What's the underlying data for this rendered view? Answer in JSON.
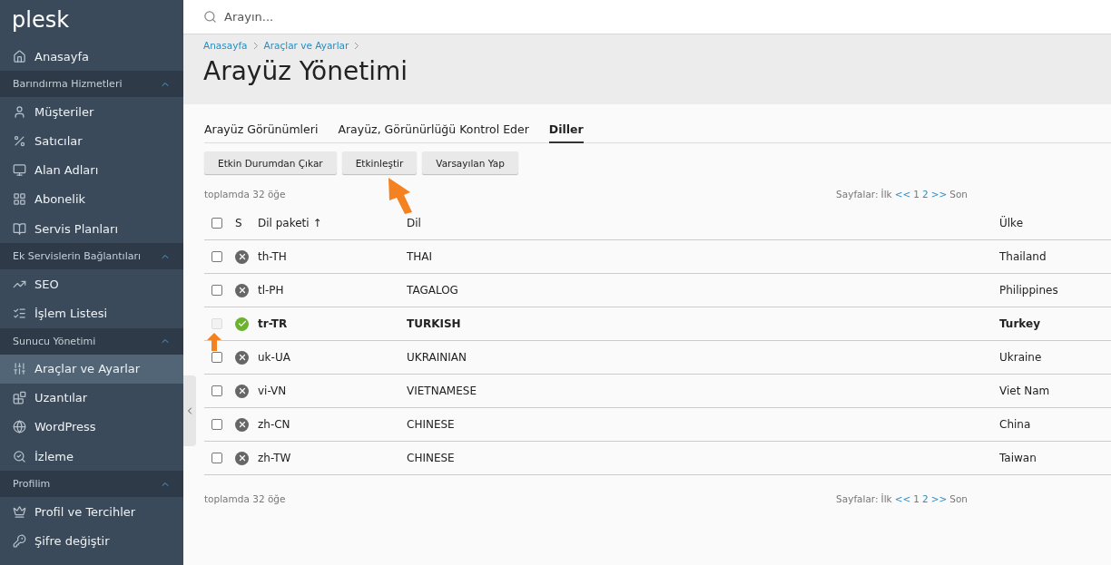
{
  "sidebar": {
    "logo": "plesk",
    "items": [
      {
        "kind": "item",
        "label": "Anasayfa",
        "selected": false
      },
      {
        "kind": "section",
        "label": "Barındırma Hizmetleri",
        "expanded": true
      },
      {
        "kind": "item",
        "label": "Müşteriler",
        "selected": false
      },
      {
        "kind": "item",
        "label": "Satıcılar",
        "selected": false
      },
      {
        "kind": "item",
        "label": "Alan Adları",
        "selected": false
      },
      {
        "kind": "item",
        "label": "Abonelik",
        "selected": false
      },
      {
        "kind": "item",
        "label": "Servis Planları",
        "selected": false
      },
      {
        "kind": "section",
        "label": "Ek Servislerin Bağlantıları",
        "expanded": true
      },
      {
        "kind": "item",
        "label": "SEO",
        "selected": false
      },
      {
        "kind": "item",
        "label": "İşlem Listesi",
        "selected": false
      },
      {
        "kind": "section",
        "label": "Sunucu Yönetimi",
        "expanded": true
      },
      {
        "kind": "item",
        "label": "Araçlar ve Ayarlar",
        "selected": true
      },
      {
        "kind": "item",
        "label": "Uzantılar",
        "selected": false
      },
      {
        "kind": "item",
        "label": "WordPress",
        "selected": false
      },
      {
        "kind": "item",
        "label": "İzleme",
        "selected": false
      },
      {
        "kind": "section",
        "label": "Profilim",
        "expanded": true
      },
      {
        "kind": "item",
        "label": "Profil ve Tercihler",
        "selected": false
      },
      {
        "kind": "item",
        "label": "Şifre değiştir",
        "selected": false
      }
    ]
  },
  "search": {
    "placeholder": "Arayın..."
  },
  "breadcrumbs": [
    "Anasayfa",
    "Araçlar ve Ayarlar"
  ],
  "title": "Arayüz Yönetimi",
  "tabs": [
    {
      "label": "Arayüz Görünümleri",
      "selected": false
    },
    {
      "label": "Arayüz, Görünürlüğü Kontrol Eder",
      "selected": false
    },
    {
      "label": "Diller",
      "selected": true
    }
  ],
  "buttons": [
    "Etkin Durumdan Çıkar",
    "Etkinleştir",
    "Varsayılan Yap"
  ],
  "total": "toplamda 32 öğe",
  "pager": {
    "label": "Sayfalar:",
    "items": [
      {
        "text": "İlk",
        "link": false
      },
      {
        "text": "<<",
        "link": true
      },
      {
        "text": "1",
        "link": false
      },
      {
        "text": "2",
        "link": true
      },
      {
        "text": ">>",
        "link": true
      },
      {
        "text": "Son",
        "link": false
      }
    ]
  },
  "table": {
    "select_all": {
      "checked": false
    },
    "columns": [
      "S",
      "Dil paketi ↑",
      "Dil",
      "Ülke"
    ],
    "rows": [
      {
        "code": "th-TH",
        "language": "THAI",
        "country": "Thailand",
        "active": false,
        "default": false,
        "checked": false
      },
      {
        "code": "tl-PH",
        "language": "TAGALOG",
        "country": "Philippines",
        "active": false,
        "default": false,
        "checked": false
      },
      {
        "code": "tr-TR",
        "language": "TURKISH",
        "country": "Turkey",
        "active": true,
        "default": true,
        "checked": false,
        "disabled": true
      },
      {
        "code": "uk-UA",
        "language": "UKRAINIAN",
        "country": "Ukraine",
        "active": false,
        "default": false,
        "checked": false
      },
      {
        "code": "vi-VN",
        "language": "VIETNAMESE",
        "country": "Viet Nam",
        "active": false,
        "default": false,
        "checked": false
      },
      {
        "code": "zh-CN",
        "language": "CHINESE",
        "country": "China",
        "active": false,
        "default": false,
        "checked": false
      },
      {
        "code": "zh-TW",
        "language": "CHINESE",
        "country": "Taiwan",
        "active": false,
        "default": false,
        "checked": false
      }
    ]
  },
  "footer_total": "toplamda 32 öğe",
  "footer_pager": {
    "label": "Sayfalar:",
    "items": [
      {
        "text": "İlk",
        "link": false
      },
      {
        "text": "<<",
        "link": true
      },
      {
        "text": "1",
        "link": false
      },
      {
        "text": "2",
        "link": true
      },
      {
        "text": ">>",
        "link": true
      },
      {
        "text": "Son",
        "link": false
      }
    ]
  }
}
